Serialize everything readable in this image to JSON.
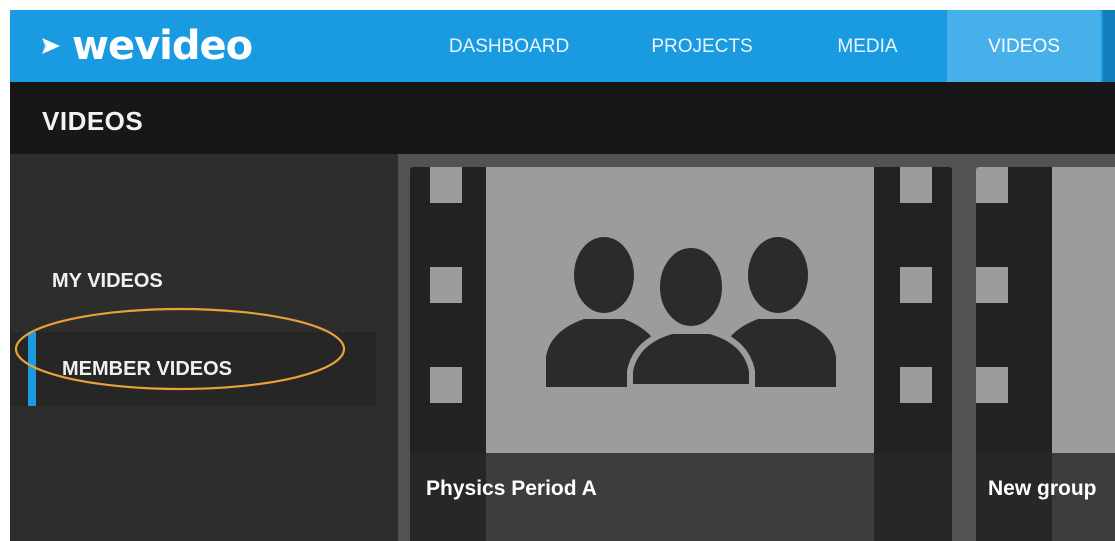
{
  "app": {
    "brand": "wevideo",
    "brand_color": "#1a9ae0"
  },
  "nav": {
    "items": [
      {
        "label": "DASHBOARD",
        "active": false
      },
      {
        "label": "PROJECTS",
        "active": false
      },
      {
        "label": "MEDIA",
        "active": false
      },
      {
        "label": "VIDEOS",
        "active": true
      }
    ]
  },
  "page": {
    "title": "VIDEOS"
  },
  "sidebar": {
    "items": [
      {
        "label": "MY VIDEOS",
        "active": false
      },
      {
        "label": "MEMBER VIDEOS",
        "active": true
      }
    ],
    "highlight_color": "#e8a23a"
  },
  "cards": [
    {
      "title": "Physics Period A",
      "thumbnail_icon": "group-icon"
    },
    {
      "title": "New group",
      "thumbnail_icon": "group-icon"
    }
  ]
}
